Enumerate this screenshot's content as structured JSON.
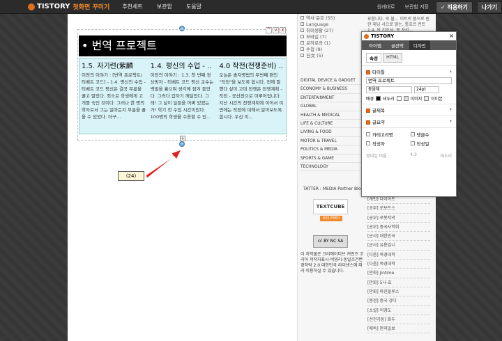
{
  "topbar": {
    "brand": "TISTORY",
    "subtitle": "첫화면 꾸미기",
    "nav": [
      "추천세트",
      "보관함",
      "도움말"
    ],
    "links": [
      "원래대로",
      "보관함 저장"
    ],
    "apply_label": "✓ 적용하기",
    "exit_label": "나가기"
  },
  "module": {
    "title": "번역 프로젝트",
    "columns": [
      {
        "heading": "1.5. 자기련(紫麟",
        "text": "이전의 이야기 : [번역 프로젝트/티베트 코드] - 1.4. 평신의 수업 - 티베트 코드 평신은 결국 무릎을 꿇고 말았다. 최소로 학생에게 고개를 숙인 것이다. 그러나 한 명의 학자로서 그는 얼마든지 무릎을 꿇을 수 있었다. 더구..."
      },
      {
        "heading": "1.4. 평신의 수업 - ..",
        "text": "이전의 이야기 : 1.3. 첫 번째 정상방자 - 티베트 코드 평신 교수는 백발을 휼으며 생각에 잠겨 들었다. 그러다 갑자기 깨달았다. 그래! 그 날이 일들을 어쩌 있겠는가! 학기 첫 수업 시간이었다. 100명의 학생을 수용할 수 있..."
      },
      {
        "heading": "4.0 작전(전쟁준비) ..",
        "text": "오늘은 솔자병법의 두번째 편인 \"작전\"을 보도록 합시다. 전에 말했다 싶이 고대 전쟁은 전쟁계획 - 작전 - 공선전으로 이루어집니다. 지난 시간의 전쟁계획에 이어서 이번에는 작전에 대해서 알아보도록 합시다. 우선 이..."
      }
    ],
    "controls": [
      "^",
      "v",
      "x"
    ]
  },
  "callout": {
    "label": "(24)"
  },
  "right": {
    "tree": [
      "역사·문호",
      "Language",
      "취미생활",
      "모바일",
      "로하로라",
      "수첩",
      "日文"
    ],
    "tree_counts": [
      "(55)",
      "",
      "(27)",
      "(7)",
      "(1)",
      "(8)",
      "(5)"
    ],
    "top_text": "요합니다, 로 불... 이트의 품으로 원한 재닝 사으로 밝는, 통호르 컨트 1.4. 의 저조사. 목 자리...",
    "categories": [
      "DIGITAL DEVICE & GADGET",
      "ECONOMY & BUSINESS",
      "ENTERTAINMENT",
      "GLOBAL",
      "HEALTH & MEDICAL",
      "LIFE & CULTURE",
      "LIVING & FOOD",
      "MOTOR & TRAVEL",
      "POLITICS & MEDIA",
      "SPORTS & GAME",
      "TECHNOLOGY"
    ],
    "partner": "TATTER : MEDIA Partner Blog",
    "textcube": "TEXTCUBE",
    "rss": "RSS FEED",
    "cc": "cc BY NC SA",
    "license": "이 저작물은 크리에이티브 커먼즈 코리아 저작자표시-비영리-동일조건변경허락 2.0 대한민국 라이센스에 따라 이용하실 수 있습니다.",
    "list": [
      "[개인] 다이어트",
      "[공부] 로보트스",
      "[공부] 로봇저녁",
      "[공부] 중국사학회",
      "[군사] 대한민국",
      "[군사] 유용입니",
      "[다음] 북경대학",
      "[다음] 북경대학",
      "[만화] Jintime",
      "[만화] 5나-효",
      "[만화] 마진블루스",
      "[봉정] 중국 강다",
      "[소설] 이영도",
      "[선전가동] 화두",
      "[애독] 판지일보"
    ]
  },
  "panel": {
    "brand": "TISTORY",
    "tabs": [
      "아이템",
      "글선택",
      "디자인"
    ],
    "subtabs": [
      "속성",
      "HTML"
    ],
    "title_section": "타이틀",
    "title_value": "번역 프로젝트",
    "font": "돋움체",
    "size": "24pt",
    "labels": [
      "배경",
      "테두리",
      "이미지",
      "이미본"
    ],
    "sec_article": "글제목",
    "sec_summary": "글요약",
    "options": [
      "카테고리명",
      "댓글수",
      "작성자",
      "작성일"
    ],
    "footer_left": "썸네일 비율",
    "footer_mid": "4:3",
    "footer_right": "테두리"
  },
  "colors": {
    "accent": "#e06e1e",
    "module_bg": "#d9f4f9",
    "arrow": "#e02020"
  }
}
